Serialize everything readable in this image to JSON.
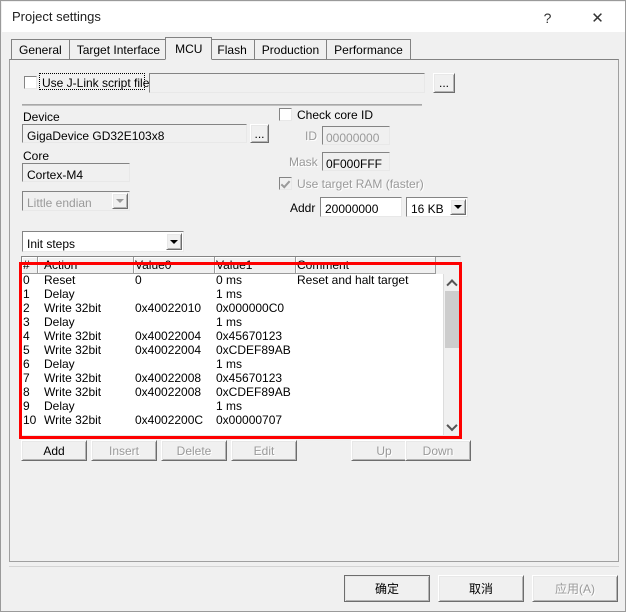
{
  "window": {
    "title": "Project settings",
    "help_label": "?",
    "close_label": "✕"
  },
  "tabs": [
    {
      "label": "General",
      "active": false
    },
    {
      "label": "Target Interface",
      "active": false
    },
    {
      "label": "MCU",
      "active": true
    },
    {
      "label": "Flash",
      "active": false
    },
    {
      "label": "Production",
      "active": false
    },
    {
      "label": "Performance",
      "active": false
    }
  ],
  "script_file": {
    "checkbox_label": "Use J-Link script file",
    "checked": false,
    "path_value": "",
    "browse_label": "..."
  },
  "device": {
    "group_label": "Device",
    "value": "GigaDevice GD32E103x8",
    "browse_label": "..."
  },
  "core": {
    "group_label": "Core",
    "value": "Cortex-M4",
    "endian_value": "Little endian"
  },
  "core_id": {
    "checkbox_label": "Check core ID",
    "checked": false,
    "id_label": "ID",
    "id_value": "00000000",
    "mask_label": "Mask",
    "mask_value": "0F000FFF"
  },
  "target_ram": {
    "checkbox_label": "Use target RAM (faster)",
    "checked": true,
    "addr_label": "Addr",
    "addr_value": "20000000",
    "size_value": "16 KB"
  },
  "steps": {
    "selector_value": "Init steps",
    "columns": [
      "#",
      "Action",
      "Value0",
      "Value1",
      "Comment"
    ],
    "rows": [
      {
        "num": "0",
        "action": "Reset",
        "value0": "0",
        "value1": "0 ms",
        "comment": "Reset and halt target"
      },
      {
        "num": "1",
        "action": "Delay",
        "value0": "",
        "value1": "1 ms",
        "comment": ""
      },
      {
        "num": "2",
        "action": "Write 32bit",
        "value0": "0x40022010",
        "value1": "0x000000C0",
        "comment": ""
      },
      {
        "num": "3",
        "action": "Delay",
        "value0": "",
        "value1": "1 ms",
        "comment": ""
      },
      {
        "num": "4",
        "action": "Write 32bit",
        "value0": "0x40022004",
        "value1": "0x45670123",
        "comment": ""
      },
      {
        "num": "5",
        "action": "Write 32bit",
        "value0": "0x40022004",
        "value1": "0xCDEF89AB",
        "comment": ""
      },
      {
        "num": "6",
        "action": "Delay",
        "value0": "",
        "value1": "1 ms",
        "comment": ""
      },
      {
        "num": "7",
        "action": "Write 32bit",
        "value0": "0x40022008",
        "value1": "0x45670123",
        "comment": ""
      },
      {
        "num": "8",
        "action": "Write 32bit",
        "value0": "0x40022008",
        "value1": "0xCDEF89AB",
        "comment": ""
      },
      {
        "num": "9",
        "action": "Delay",
        "value0": "",
        "value1": "1 ms",
        "comment": ""
      },
      {
        "num": "10",
        "action": "Write 32bit",
        "value0": "0x4002200C",
        "value1": "0x00000707",
        "comment": ""
      }
    ]
  },
  "list_buttons": {
    "add": "Add",
    "insert": "Insert",
    "delete": "Delete",
    "edit": "Edit",
    "up": "Up",
    "down": "Down"
  },
  "dialog_buttons": {
    "ok": "确定",
    "cancel": "取消",
    "apply": "应用(A)"
  },
  "colors": {
    "annotation_red": "#fe0000",
    "dialog_face": "#f0f0f0",
    "field_white": "#ffffff",
    "disabled_text": "#9a9a9a"
  }
}
